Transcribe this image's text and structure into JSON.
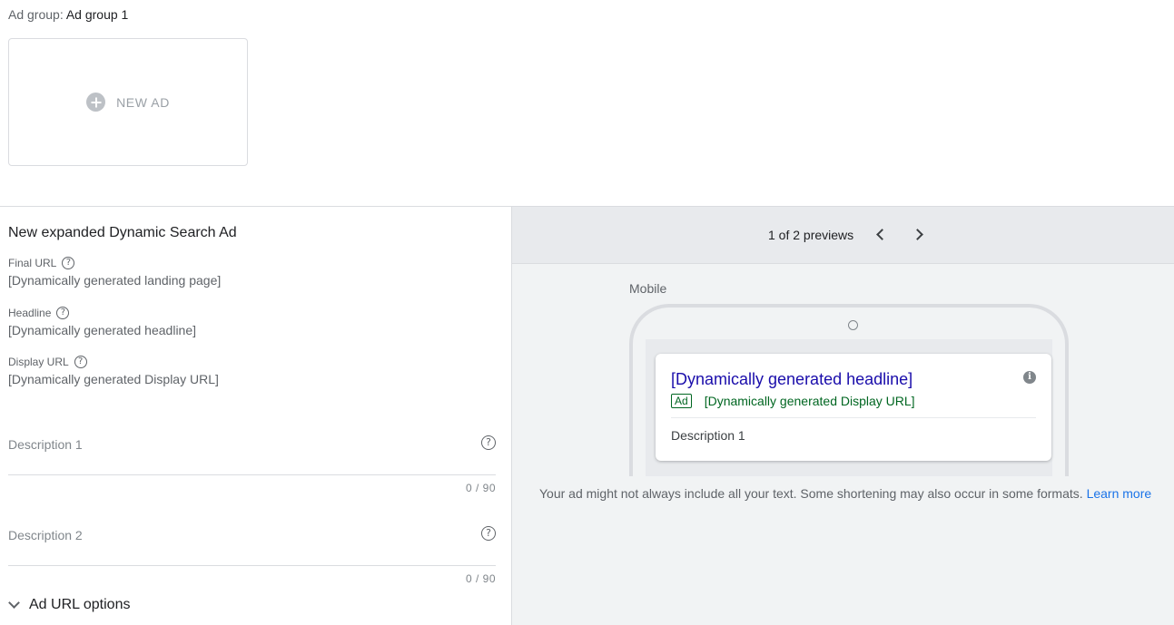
{
  "ad_group": {
    "label": "Ad group:",
    "value": "Ad group 1"
  },
  "new_ad": {
    "label": "NEW AD",
    "icon": "add-circle-icon"
  },
  "form": {
    "title": "New expanded Dynamic Search Ad",
    "final_url": {
      "label": "Final URL",
      "value": "[Dynamically generated landing page]"
    },
    "headline": {
      "label": "Headline",
      "value": "[Dynamically generated headline]"
    },
    "display_url": {
      "label": "Display URL",
      "value": "[Dynamically generated Display URL]"
    },
    "description1": {
      "placeholder": "Description 1",
      "counter": "0 / 90"
    },
    "description2": {
      "placeholder": "Description 2",
      "counter": "0 / 90"
    },
    "url_options": {
      "label": "Ad URL options"
    }
  },
  "preview": {
    "count_text": "1 of 2 previews",
    "device": "Mobile",
    "ad": {
      "headline": "[Dynamically generated headline]",
      "badge": "Ad",
      "display_url": "[Dynamically generated Display URL]",
      "description": "Description 1"
    },
    "note": "Your ad might not always include all your text. Some shortening may also occur in some formats.",
    "learn_more": "Learn more"
  },
  "colors": {
    "headline_link": "#1a0dab",
    "url_green": "#006621",
    "link_blue": "#1a73e8"
  }
}
